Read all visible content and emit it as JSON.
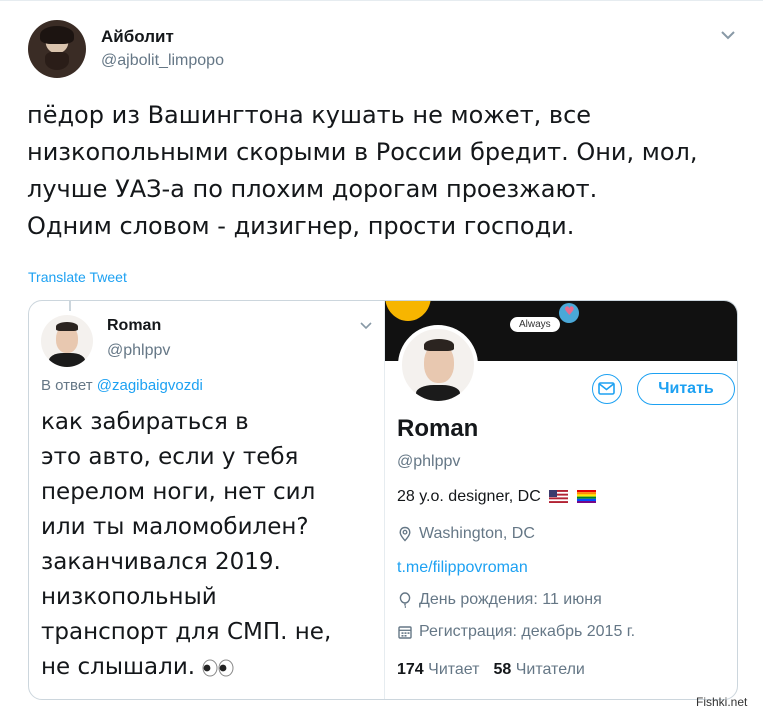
{
  "tweet": {
    "author_name": "Айболит",
    "author_handle": "@ajbolit_limpopo",
    "text": "пёдор из Вашингтона кушать не может, все\nнизкопольными скорыми в России бредит. Они, мол,\nлучше УАЗ-а по плохим дорогам проезжают.\nОдним словом - дизигнер, прости господи.",
    "translate_label": "Translate Tweet"
  },
  "embedded_tweet": {
    "author_name": "Roman",
    "author_handle": "@phlppv",
    "reply_prefix": "В ответ",
    "reply_mention": "@zagibaigvozdi",
    "text": "как забираться в\nэто авто, если у тебя\nперелом ноги, нет сил\nили ты маломобилен?\nзаканчивался 2019.\nнизкопольный\nтранспорт для СМП. не,\nне слышали."
  },
  "profile": {
    "banner_bubble": "Always",
    "name": "Roman",
    "handle": "@phlppv",
    "bio": "28 y.o. designer, DC",
    "location": "Washington, DC",
    "link": "t.me/filippovroman",
    "birthday": "День рождения: 11 июня",
    "joined": "Регистрация: декабрь 2015 г.",
    "following_count": "174",
    "following_label": "Читает",
    "followers_count": "58",
    "followers_label": "Читатели",
    "follow_button": "Читать"
  },
  "watermark": "Fishki.net",
  "colors": {
    "accent": "#1da1f2",
    "muted": "#657786",
    "text": "#14171a",
    "border": "#ccd6dd"
  }
}
